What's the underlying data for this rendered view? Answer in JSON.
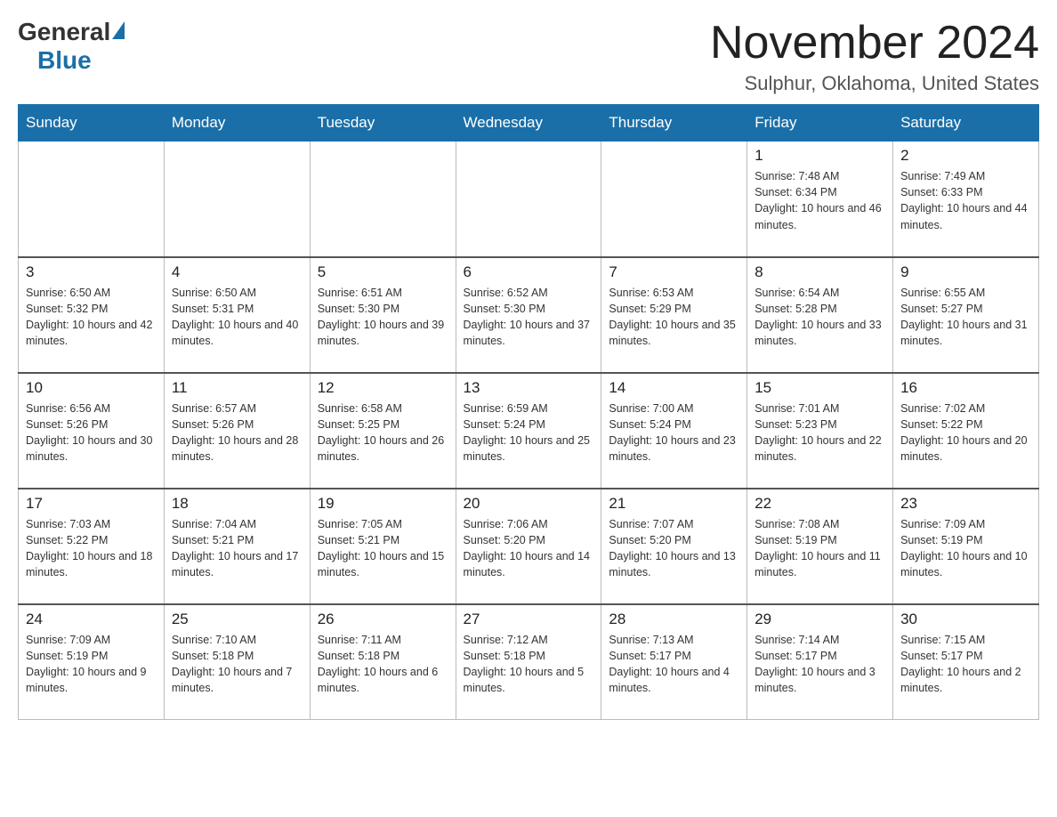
{
  "logo": {
    "general": "General",
    "blue": "Blue"
  },
  "title": "November 2024",
  "subtitle": "Sulphur, Oklahoma, United States",
  "days_of_week": [
    "Sunday",
    "Monday",
    "Tuesday",
    "Wednesday",
    "Thursday",
    "Friday",
    "Saturday"
  ],
  "weeks": [
    [
      {
        "day": "",
        "info": ""
      },
      {
        "day": "",
        "info": ""
      },
      {
        "day": "",
        "info": ""
      },
      {
        "day": "",
        "info": ""
      },
      {
        "day": "",
        "info": ""
      },
      {
        "day": "1",
        "info": "Sunrise: 7:48 AM\nSunset: 6:34 PM\nDaylight: 10 hours and 46 minutes."
      },
      {
        "day": "2",
        "info": "Sunrise: 7:49 AM\nSunset: 6:33 PM\nDaylight: 10 hours and 44 minutes."
      }
    ],
    [
      {
        "day": "3",
        "info": "Sunrise: 6:50 AM\nSunset: 5:32 PM\nDaylight: 10 hours and 42 minutes."
      },
      {
        "day": "4",
        "info": "Sunrise: 6:50 AM\nSunset: 5:31 PM\nDaylight: 10 hours and 40 minutes."
      },
      {
        "day": "5",
        "info": "Sunrise: 6:51 AM\nSunset: 5:30 PM\nDaylight: 10 hours and 39 minutes."
      },
      {
        "day": "6",
        "info": "Sunrise: 6:52 AM\nSunset: 5:30 PM\nDaylight: 10 hours and 37 minutes."
      },
      {
        "day": "7",
        "info": "Sunrise: 6:53 AM\nSunset: 5:29 PM\nDaylight: 10 hours and 35 minutes."
      },
      {
        "day": "8",
        "info": "Sunrise: 6:54 AM\nSunset: 5:28 PM\nDaylight: 10 hours and 33 minutes."
      },
      {
        "day": "9",
        "info": "Sunrise: 6:55 AM\nSunset: 5:27 PM\nDaylight: 10 hours and 31 minutes."
      }
    ],
    [
      {
        "day": "10",
        "info": "Sunrise: 6:56 AM\nSunset: 5:26 PM\nDaylight: 10 hours and 30 minutes."
      },
      {
        "day": "11",
        "info": "Sunrise: 6:57 AM\nSunset: 5:26 PM\nDaylight: 10 hours and 28 minutes."
      },
      {
        "day": "12",
        "info": "Sunrise: 6:58 AM\nSunset: 5:25 PM\nDaylight: 10 hours and 26 minutes."
      },
      {
        "day": "13",
        "info": "Sunrise: 6:59 AM\nSunset: 5:24 PM\nDaylight: 10 hours and 25 minutes."
      },
      {
        "day": "14",
        "info": "Sunrise: 7:00 AM\nSunset: 5:24 PM\nDaylight: 10 hours and 23 minutes."
      },
      {
        "day": "15",
        "info": "Sunrise: 7:01 AM\nSunset: 5:23 PM\nDaylight: 10 hours and 22 minutes."
      },
      {
        "day": "16",
        "info": "Sunrise: 7:02 AM\nSunset: 5:22 PM\nDaylight: 10 hours and 20 minutes."
      }
    ],
    [
      {
        "day": "17",
        "info": "Sunrise: 7:03 AM\nSunset: 5:22 PM\nDaylight: 10 hours and 18 minutes."
      },
      {
        "day": "18",
        "info": "Sunrise: 7:04 AM\nSunset: 5:21 PM\nDaylight: 10 hours and 17 minutes."
      },
      {
        "day": "19",
        "info": "Sunrise: 7:05 AM\nSunset: 5:21 PM\nDaylight: 10 hours and 15 minutes."
      },
      {
        "day": "20",
        "info": "Sunrise: 7:06 AM\nSunset: 5:20 PM\nDaylight: 10 hours and 14 minutes."
      },
      {
        "day": "21",
        "info": "Sunrise: 7:07 AM\nSunset: 5:20 PM\nDaylight: 10 hours and 13 minutes."
      },
      {
        "day": "22",
        "info": "Sunrise: 7:08 AM\nSunset: 5:19 PM\nDaylight: 10 hours and 11 minutes."
      },
      {
        "day": "23",
        "info": "Sunrise: 7:09 AM\nSunset: 5:19 PM\nDaylight: 10 hours and 10 minutes."
      }
    ],
    [
      {
        "day": "24",
        "info": "Sunrise: 7:09 AM\nSunset: 5:19 PM\nDaylight: 10 hours and 9 minutes."
      },
      {
        "day": "25",
        "info": "Sunrise: 7:10 AM\nSunset: 5:18 PM\nDaylight: 10 hours and 7 minutes."
      },
      {
        "day": "26",
        "info": "Sunrise: 7:11 AM\nSunset: 5:18 PM\nDaylight: 10 hours and 6 minutes."
      },
      {
        "day": "27",
        "info": "Sunrise: 7:12 AM\nSunset: 5:18 PM\nDaylight: 10 hours and 5 minutes."
      },
      {
        "day": "28",
        "info": "Sunrise: 7:13 AM\nSunset: 5:17 PM\nDaylight: 10 hours and 4 minutes."
      },
      {
        "day": "29",
        "info": "Sunrise: 7:14 AM\nSunset: 5:17 PM\nDaylight: 10 hours and 3 minutes."
      },
      {
        "day": "30",
        "info": "Sunrise: 7:15 AM\nSunset: 5:17 PM\nDaylight: 10 hours and 2 minutes."
      }
    ]
  ]
}
